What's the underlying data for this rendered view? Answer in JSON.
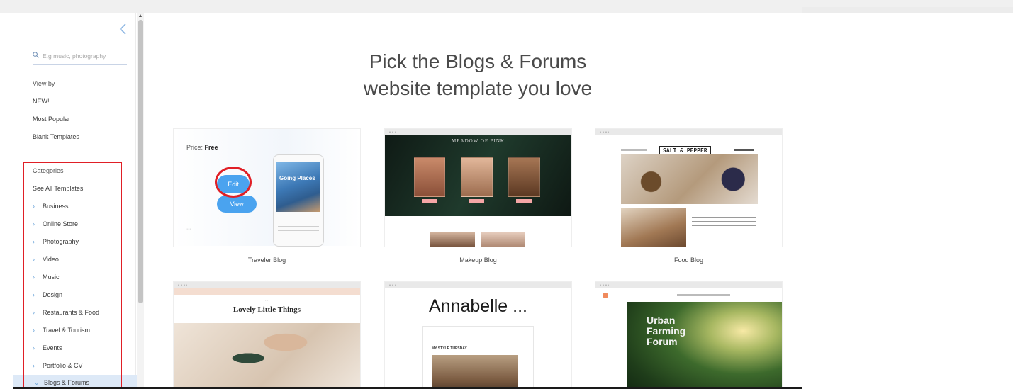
{
  "sidebar": {
    "search_placeholder": "E.g music, photography",
    "view_by_label": "View by",
    "view_by_items": [
      "NEW!",
      "Most Popular",
      "Blank Templates"
    ],
    "categories_label": "Categories",
    "see_all_label": "See All Templates",
    "categories": [
      "Business",
      "Online Store",
      "Photography",
      "Video",
      "Music",
      "Design",
      "Restaurants & Food",
      "Travel & Tourism",
      "Events",
      "Portfolio & CV",
      "Blogs & Forums"
    ],
    "active_category": "Blogs & Forums"
  },
  "main": {
    "headline_line1": "Pick the Blogs & Forums",
    "headline_line2": "website template you love",
    "templates": [
      {
        "label": "Traveler Blog"
      },
      {
        "label": "Makeup Blog"
      },
      {
        "label": "Food Blog"
      },
      {
        "label": ""
      },
      {
        "label": ""
      },
      {
        "label": ""
      }
    ],
    "hover_card": {
      "price_label": "Price:",
      "price_value": "Free",
      "edit_label": "Edit",
      "view_label": "View",
      "phone_caption": "Going Places"
    },
    "food_card_title": "SALT & PEPPER",
    "lovely_card_title": "Lovely Little Things",
    "annabelle_card_title": "Annabelle ...",
    "annabelle_post_title": "MY STYLE TUESDAY",
    "urban_card_title": "Urban Farming Forum",
    "makeup_card_title": "MEADOW OF PINK"
  },
  "colors": {
    "accent_blue": "#4aa3ef",
    "highlight_red": "#e01f26",
    "active_row_bg": "#dde9f7"
  },
  "icons": [
    "search-icon",
    "chevron-left-icon",
    "chevron-right-icon",
    "chevron-down-icon"
  ]
}
